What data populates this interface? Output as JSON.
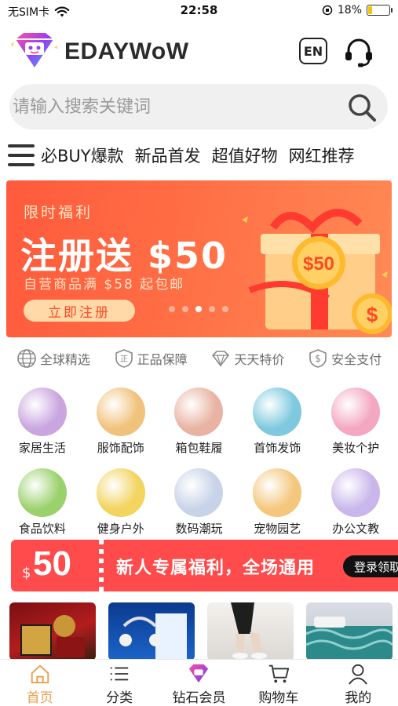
{
  "status_bar": {
    "carrier": "无SIM卡",
    "time": "22:58",
    "battery_text": "18%",
    "battery_level": 0.18
  },
  "header": {
    "brand": "EDAYWoW",
    "lang_button": "EN"
  },
  "search": {
    "placeholder": "请输入搜索关键词"
  },
  "category_tabs": [
    "必BUY爆款",
    "新品首发",
    "超值好物",
    "网红推荐"
  ],
  "banner": {
    "tag": "限时福利",
    "title": "注册送 $50",
    "subtitle": "自营商品满 $58 起包邮",
    "button": "立即注册",
    "coin_label": "$50",
    "slide_count": 5,
    "active_slide": 2
  },
  "assurances": [
    {
      "label": "全球精选",
      "icon": "globe-icon"
    },
    {
      "label": "正品保障",
      "icon": "authentic-badge-icon"
    },
    {
      "label": "天天特价",
      "icon": "diamond-icon"
    },
    {
      "label": "安全支付",
      "icon": "dollar-shield-icon"
    }
  ],
  "categories": [
    {
      "label": "家居生活",
      "color": "#c9a6e0"
    },
    {
      "label": "服饰配饰",
      "color": "#f1c27b"
    },
    {
      "label": "箱包鞋履",
      "color": "#e8b3a2"
    },
    {
      "label": "首饰发饰",
      "color": "#7ec9de"
    },
    {
      "label": "美妆个护",
      "color": "#f3a7c1"
    },
    {
      "label": "食品饮料",
      "color": "#9bd16c"
    },
    {
      "label": "健身户外",
      "color": "#f2d45e"
    },
    {
      "label": "数码潮玩",
      "color": "#c7d3e8"
    },
    {
      "label": "宠物园艺",
      "color": "#f4c77d"
    },
    {
      "label": "办公文教",
      "color": "#c9b6ea"
    }
  ],
  "coupon": {
    "currency": "$",
    "value": "50",
    "text": "新人专属福利，全场通用",
    "button": "登录领取"
  },
  "tabbar": [
    {
      "label": "首页",
      "icon": "home-icon",
      "active": true
    },
    {
      "label": "分类",
      "icon": "list-icon",
      "active": false
    },
    {
      "label": "钻石会员",
      "icon": "diamond-member-icon",
      "active": false
    },
    {
      "label": "购物车",
      "icon": "cart-icon",
      "active": false
    },
    {
      "label": "我的",
      "icon": "user-icon",
      "active": false
    }
  ],
  "colors": {
    "accent": "#ff5a3c",
    "coupon": "#ff4b4b",
    "active_tab": "#e8a04a"
  }
}
